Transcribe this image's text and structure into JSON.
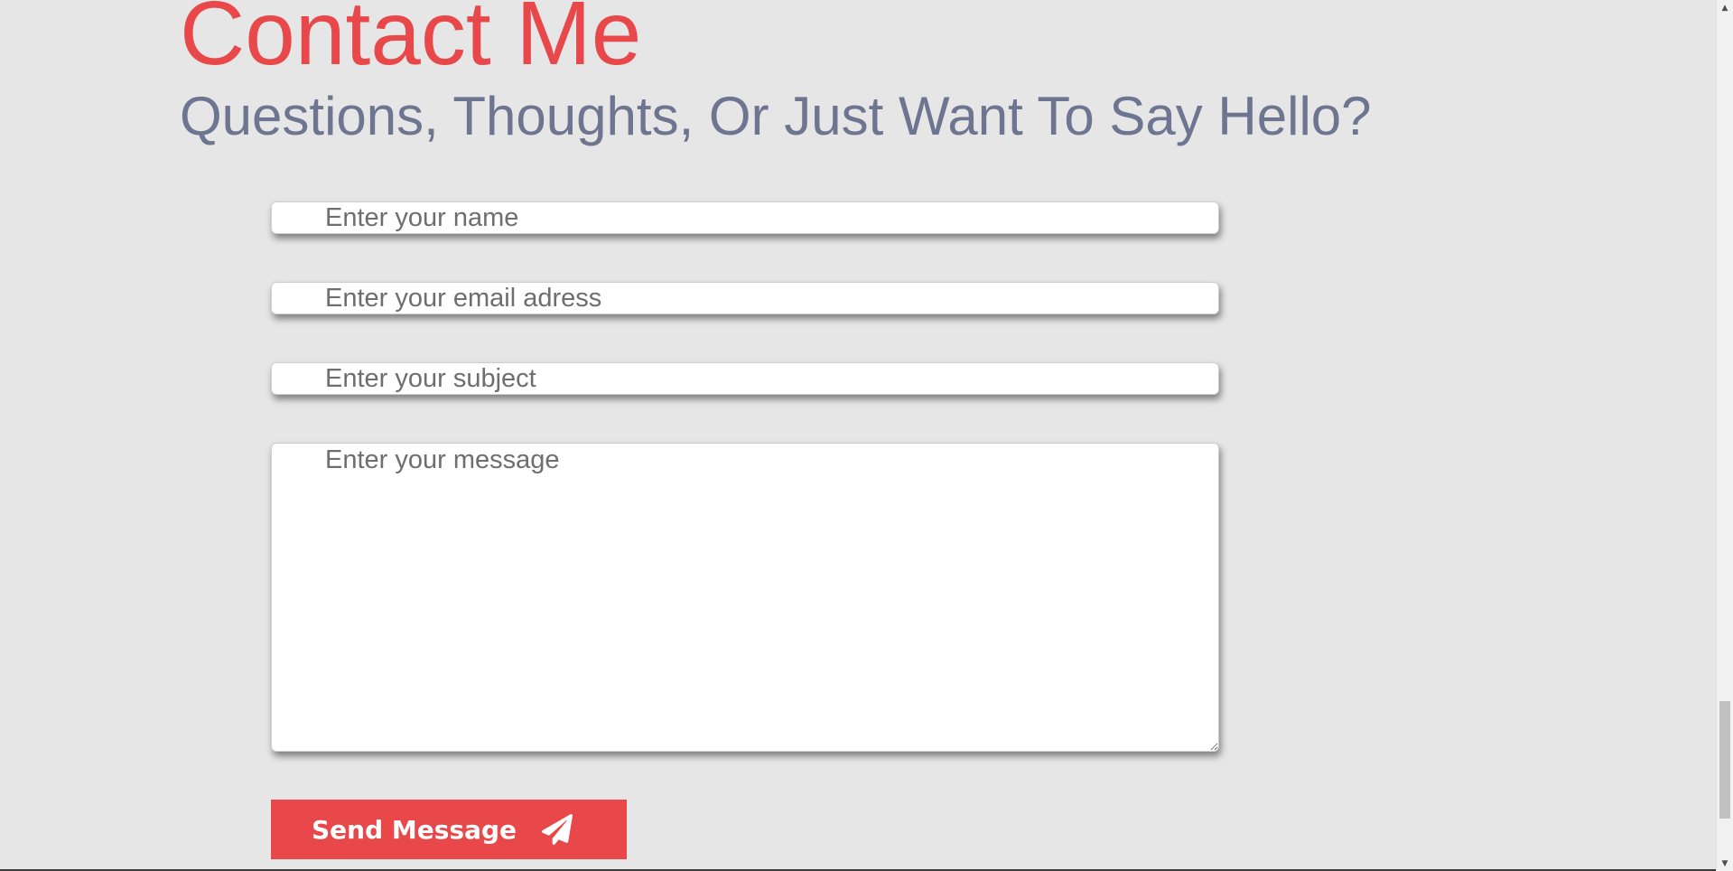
{
  "contact": {
    "title": "Contact Me",
    "subtitle": "Questions, Thoughts, Or Just Want To Say Hello?"
  },
  "form": {
    "name_placeholder": "Enter your name",
    "email_placeholder": "Enter your email adress",
    "subject_placeholder": "Enter your subject",
    "message_placeholder": "Enter your message",
    "send_label": "Send Message",
    "send_icon": "paper-plane-icon"
  },
  "colors": {
    "accent": "#e8484a",
    "subtitle": "#6e7591",
    "background": "#e6e6e6"
  }
}
